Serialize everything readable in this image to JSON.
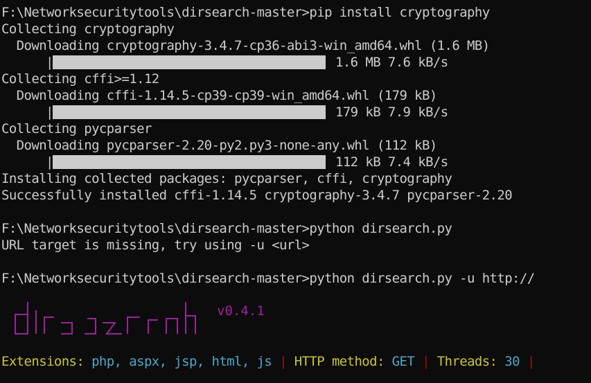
{
  "terminal": {
    "lines": [
      "F:\\Networksecuritytools\\dirsearch-master>pip install cryptography",
      "Collecting cryptography",
      "  Downloading cryptography-3.4.7-cp36-abi3-win_amd64.whl (1.6 MB)",
      "1.6 MB 7.6 kB/s",
      "Collecting cffi>=1.12",
      "  Downloading cffi-1.14.5-cp39-cp39-win_amd64.whl (179 kB)",
      "179 kB 7.9 kB/s",
      "Collecting pycparser",
      "  Downloading pycparser-2.20-py2.py3-none-any.whl (112 kB)",
      "112 kB 7.4 kB/s",
      "Installing collected packages: pycparser, cffi, cryptography",
      "Successfully installed cffi-1.14.5 cryptography-3.4.7 pycparser-2.20",
      "",
      "F:\\Networksecuritytools\\dirsearch-master>python dirsearch.py",
      "URL target is missing, try using -u <url>",
      "",
      "F:\\Networksecuritytools\\dirsearch-master>python dirsearch.py -u http://"
    ],
    "progress": [
      {
        "fraction": 1.0,
        "text": "1.6 MB 7.6 kB/s"
      },
      {
        "fraction": 1.0,
        "text": "179 kB 7.9 kB/s"
      },
      {
        "fraction": 1.0,
        "text": "112 kB 7.4 kB/s"
      }
    ],
    "version": "v0.4.1",
    "status": {
      "extensions_label": "Extensions:",
      "extensions_value": "php, aspx, jsp, html, js",
      "sep": "|",
      "method_label": "HTTP method:",
      "method_value": "GET",
      "threads_label": "Threads:",
      "threads_value": "30"
    },
    "colors": {
      "background": "#0c0c0c",
      "text": "#cccccc",
      "banner": "#a020a0",
      "label": "#c8c82a",
      "value": "#4aa8c8",
      "separator": "#a01010"
    }
  }
}
